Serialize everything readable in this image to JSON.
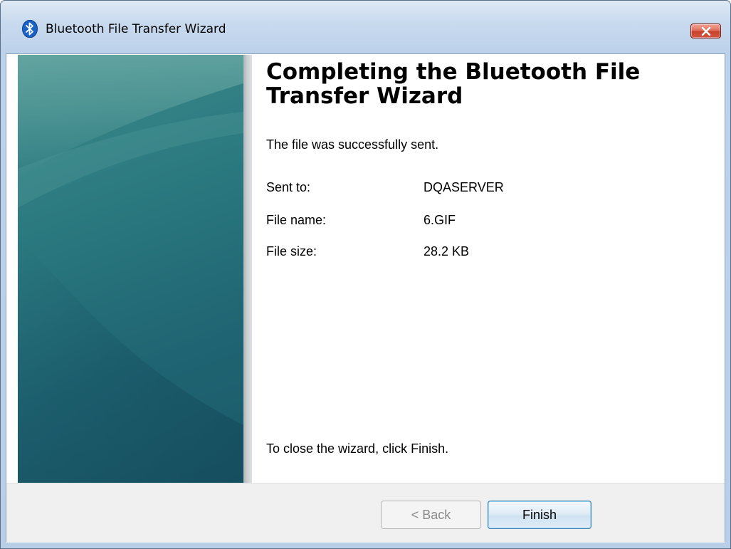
{
  "window": {
    "title": "Bluetooth File Transfer Wizard",
    "title_icon": "bluetooth-icon",
    "close_icon": "close-icon",
    "accent_color": "#c7412c"
  },
  "content": {
    "heading": "Completing the Bluetooth File Transfer Wizard",
    "status": "The file was successfully sent.",
    "details": [
      {
        "label": "Sent to:",
        "value": "DQASERVER"
      },
      {
        "label": "File name:",
        "value": "6.GIF"
      },
      {
        "label": "File size:",
        "value": "28.2 KB"
      }
    ],
    "instruction": "To close the wizard, click Finish."
  },
  "buttons": {
    "back": "< Back",
    "back_enabled": false,
    "finish": "Finish"
  }
}
